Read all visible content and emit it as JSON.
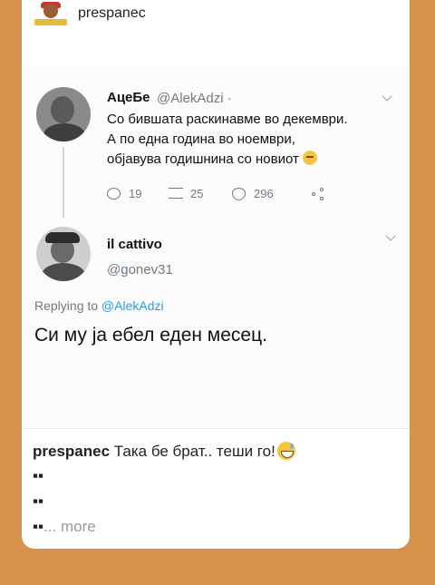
{
  "post": {
    "username": "prespanec"
  },
  "tweet": {
    "name": "АцеБе",
    "handle": "@AlekAdzi ·",
    "lines": [
      "Со бившата раскинавме во декември.",
      "А по една година во ноември,",
      "објавува годишнина со новиот"
    ],
    "stats": {
      "replies": "19",
      "retweets": "25",
      "likes": "296"
    }
  },
  "reply": {
    "name": "il cattivo",
    "handle": "@gonev31",
    "replying_prefix": "Replying to ",
    "replying_to": "@AlekAdzi",
    "text": "Си му ја ебел еден месец."
  },
  "caption": {
    "username": "prespanec",
    "text": " Така бе брат.. теши го!",
    "line1": "▪▪",
    "line2": "▪▪",
    "line3": "▪▪",
    "more": "... more"
  }
}
